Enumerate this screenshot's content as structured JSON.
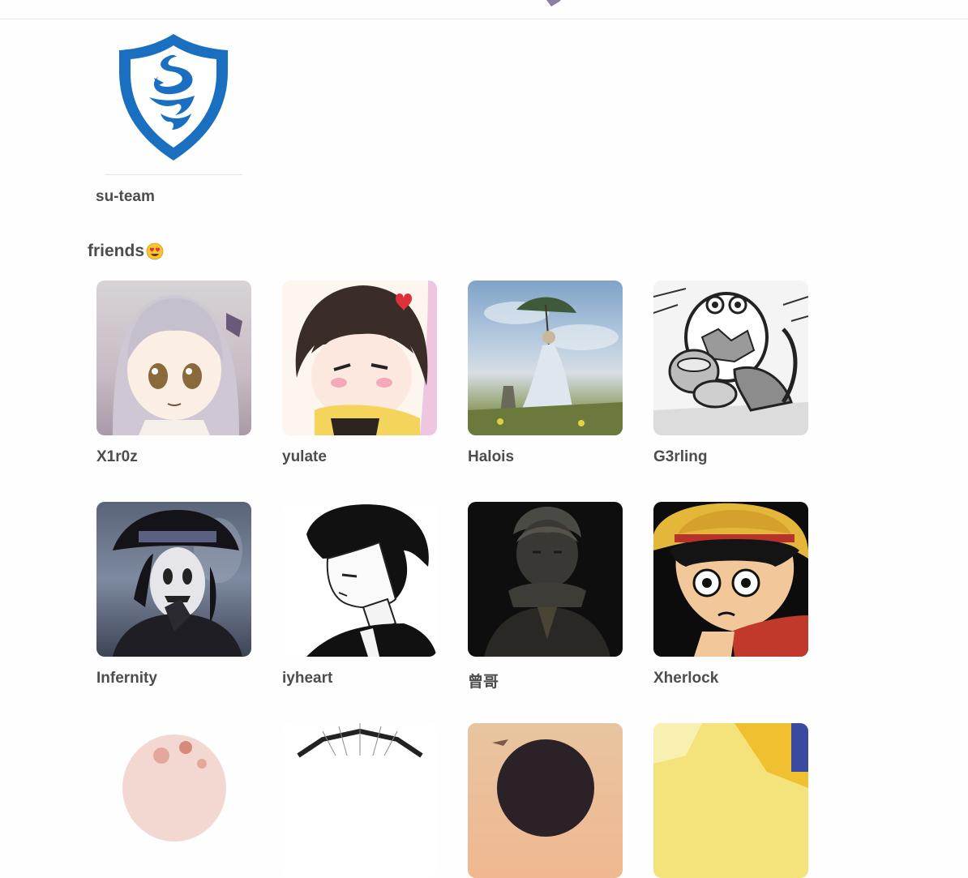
{
  "team": {
    "name": "su-team",
    "logo_icon": "shield-dragon-logo",
    "logo_color": "#1a6fc0"
  },
  "friends": {
    "heading": "friends",
    "heading_icon": "heart-eyes-emoji",
    "items": [
      {
        "name": "X1r0z",
        "avatar_icon": "anime-girl-avatar"
      },
      {
        "name": "yulate",
        "avatar_icon": "chibi-girl-avatar"
      },
      {
        "name": "Halois",
        "avatar_icon": "painting-woman-umbrella-avatar"
      },
      {
        "name": "G3rling",
        "avatar_icon": "manga-egg-creature-avatar"
      },
      {
        "name": "Infernity",
        "avatar_icon": "masked-man-hat-avatar"
      },
      {
        "name": "iyheart",
        "avatar_icon": "manga-boy-sketch-avatar"
      },
      {
        "name": "曾哥",
        "avatar_icon": "dark-anime-boy-avatar"
      },
      {
        "name": "Xherlock",
        "avatar_icon": "straw-hat-boy-avatar"
      },
      {
        "name": "",
        "avatar_icon": "pink-blossom-avatar"
      },
      {
        "name": "",
        "avatar_icon": "black-white-rays-avatar"
      },
      {
        "name": "",
        "avatar_icon": "sunset-silhouette-avatar"
      },
      {
        "name": "",
        "avatar_icon": "yellow-anime-avatar"
      }
    ]
  },
  "colors": {
    "text": "#4d4d4d",
    "background": "#fefefe",
    "divider": "#e6e6e6"
  }
}
